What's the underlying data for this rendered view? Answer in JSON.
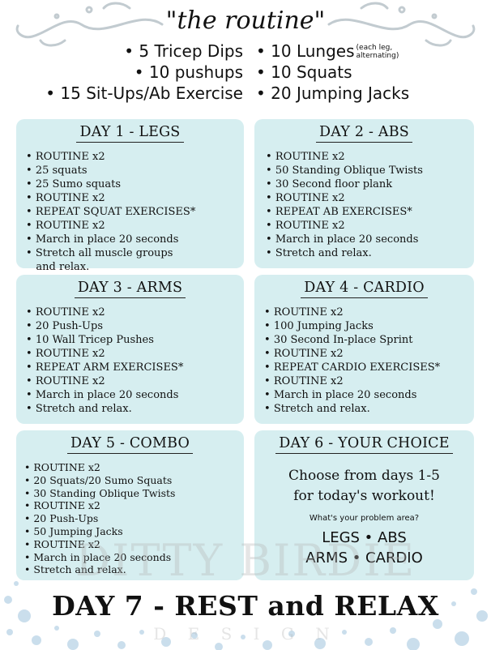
{
  "header": {
    "title": "\"the routine\"",
    "routine_left": [
      "5 Tricep Dips",
      "10 pushups",
      "15 Sit-Ups/Ab Exercise"
    ],
    "routine_right": [
      "10 Lunges",
      "10 Squats",
      "20 Jumping Jacks"
    ],
    "lunges_note_line1": "(each leg,",
    "lunges_note_line2": "alternating)"
  },
  "days": [
    {
      "title": "DAY 1 - LEGS",
      "items": [
        "ROUTINE x2",
        "25 squats",
        "25 Sumo squats",
        "ROUTINE x2",
        "REPEAT SQUAT EXERCISES*",
        "ROUTINE x2",
        "March in place 20 seconds",
        "Stretch all muscle groups"
      ],
      "continuation": "and relax."
    },
    {
      "title": "DAY 2 - ABS",
      "items": [
        "ROUTINE x2",
        "50 Standing Oblique Twists",
        "30 Second floor plank",
        "ROUTINE x2",
        "REPEAT AB EXERCISES*",
        "ROUTINE x2",
        "March in place 20 seconds",
        "Stretch and relax."
      ]
    },
    {
      "title": "DAY 3 - ARMS",
      "items": [
        "ROUTINE x2",
        "20 Push-Ups",
        "10 Wall Tricep Pushes",
        "ROUTINE x2",
        "REPEAT ARM EXERCISES*",
        "ROUTINE x2",
        "March in place 20 seconds",
        "Stretch and relax."
      ]
    },
    {
      "title": "DAY 4 - CARDIO",
      "items": [
        "ROUTINE x2",
        "100 Jumping Jacks",
        "30 Second In-place Sprint",
        "ROUTINE x2",
        "REPEAT CARDIO EXERCISES*",
        "ROUTINE x2",
        "March in place 20 seconds",
        "Stretch and relax."
      ]
    },
    {
      "title": "DAY 5 - COMBO",
      "items": [
        "ROUTINE x2",
        "20 Squats/20 Sumo Squats",
        "30 Standing Oblique Twists",
        "ROUTINE x2",
        "20 Push-Ups",
        "50 Jumping Jacks",
        "ROUTINE x2",
        "March in place 20 seconds",
        "Stretch and relax."
      ]
    },
    {
      "title": "DAY 6 - YOUR CHOICE",
      "choice_line1": "Choose from days 1-5",
      "choice_line2": "for today's workout!",
      "question": "What's your problem area?",
      "options_line1": "LEGS • ABS",
      "options_line2": "ARMS • CARDIO"
    }
  ],
  "footer": {
    "day7": "DAY 7 - REST and RELAX"
  },
  "watermark": {
    "line1": "DITTY BIRDIE",
    "line2": "D E S I G N"
  },
  "colors": {
    "card_bg": "#d6eef0",
    "swirl": "#c2cbd0",
    "dots": "#b9d3e6"
  }
}
